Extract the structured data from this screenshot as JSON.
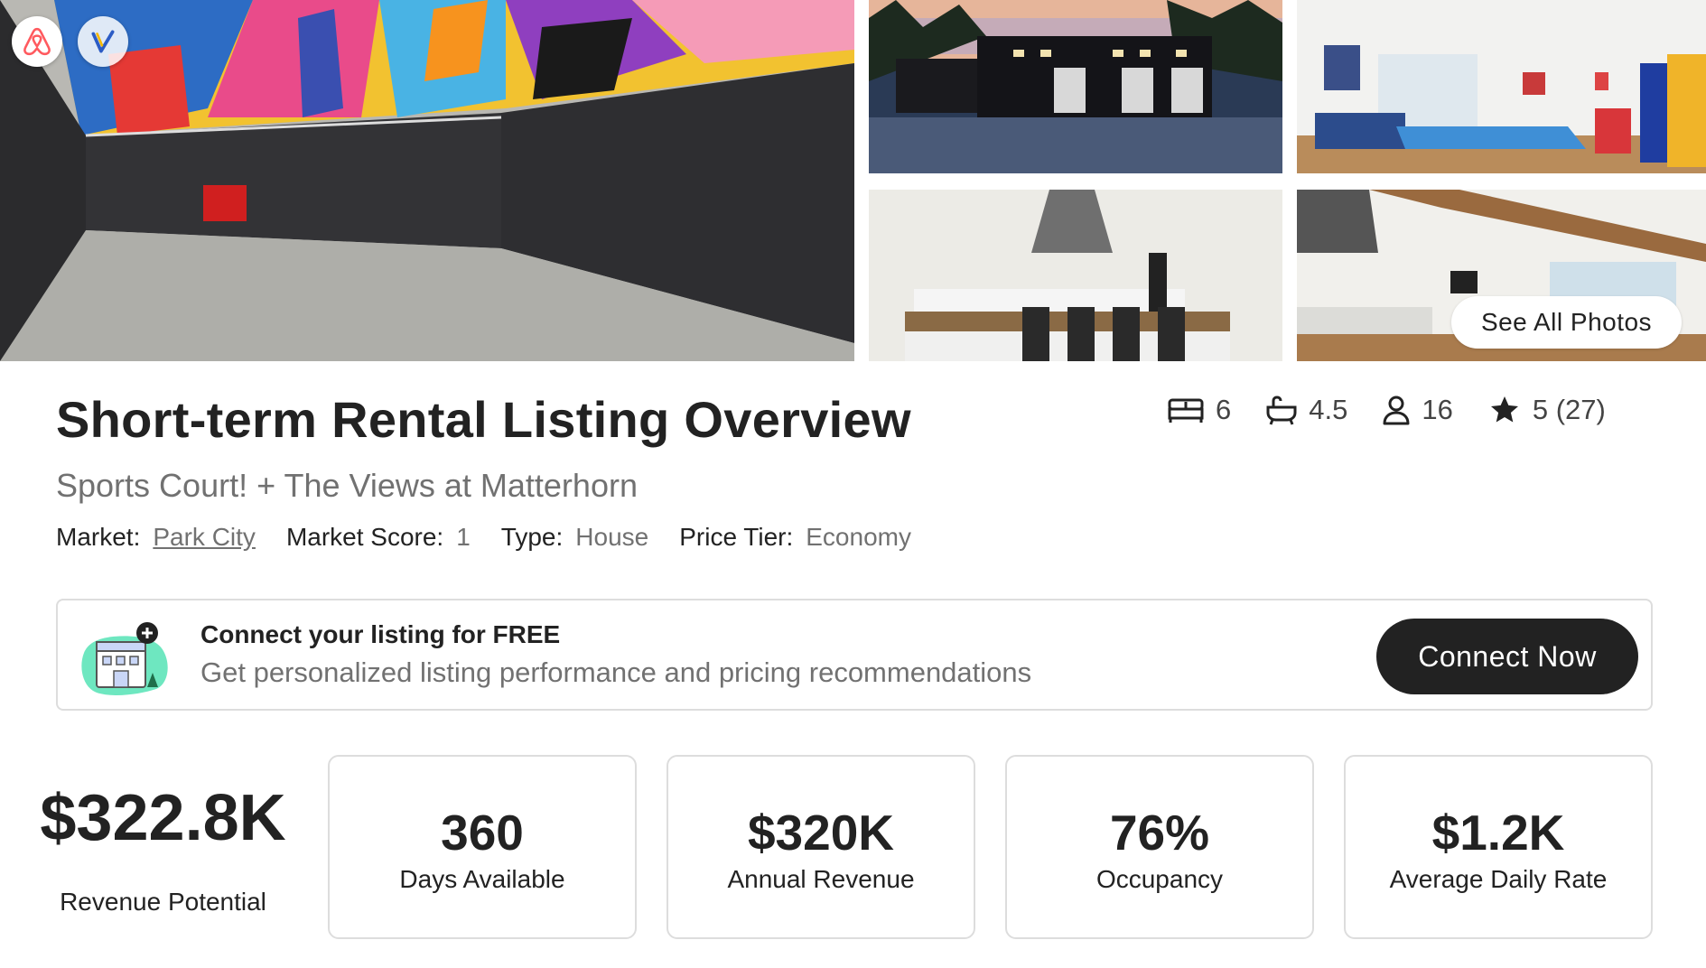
{
  "gallery": {
    "photos": [
      "sports-court",
      "house-exterior",
      "game-room",
      "kitchen",
      "living-room"
    ],
    "see_all_label": "See All Photos",
    "platforms": [
      "airbnb",
      "vrbo"
    ]
  },
  "listing": {
    "title": "Short-term Rental Listing Overview",
    "name": "Sports Court! + The Views at Matterhorn",
    "meta": {
      "market_label": "Market:",
      "market_value": "Park City",
      "score_label": "Market Score:",
      "score_value": "1",
      "type_label": "Type:",
      "type_value": "House",
      "tier_label": "Price Tier:",
      "tier_value": "Economy"
    },
    "stats": {
      "bedrooms": "6",
      "bathrooms": "4.5",
      "guests": "16",
      "rating": "5 (27)"
    }
  },
  "banner": {
    "title": "Connect your listing for FREE",
    "description": "Get personalized listing performance and pricing recommendations",
    "button_label": "Connect Now"
  },
  "metrics": {
    "revenue_potential": {
      "value": "$322.8K",
      "label": "Revenue Potential"
    },
    "cards": [
      {
        "value": "360",
        "label": "Days Available"
      },
      {
        "value": "$320K",
        "label": "Annual Revenue"
      },
      {
        "value": "76%",
        "label": "Occupancy"
      },
      {
        "value": "$1.2K",
        "label": "Average Daily Rate"
      }
    ]
  },
  "colors": {
    "text_primary": "#222222",
    "text_secondary": "#717171",
    "border": "#dddddd",
    "button_dark": "#222222",
    "airbnb_brand": "#FF5A5F",
    "banner_icon_mint": "#6EE7C0"
  }
}
